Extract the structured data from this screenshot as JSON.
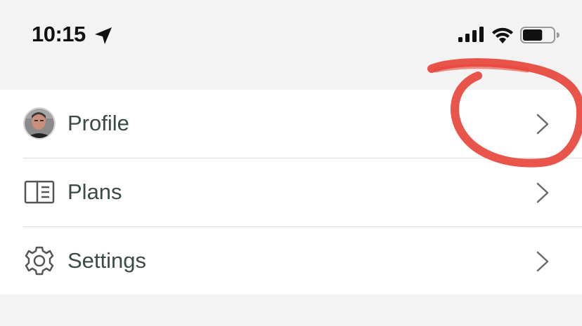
{
  "status_bar": {
    "time": "10:15",
    "location_icon": "location-arrow-icon",
    "signal_icon": "cellular-signal-icon",
    "wifi_icon": "wifi-icon",
    "battery_icon": "battery-icon",
    "battery_level": 0.65
  },
  "menu": {
    "items": [
      {
        "label": "Profile",
        "icon": "avatar",
        "chevron": "chevron-right-icon"
      },
      {
        "label": "Plans",
        "icon": "plans-icon",
        "chevron": "chevron-right-icon"
      },
      {
        "label": "Settings",
        "icon": "gear-icon",
        "chevron": "chevron-right-icon"
      }
    ]
  },
  "colors": {
    "background": "#f3f3f3",
    "card": "#ffffff",
    "label_text": "#3a4a47",
    "chevron": "#6b6b6b",
    "annotation": "#e8473c"
  }
}
